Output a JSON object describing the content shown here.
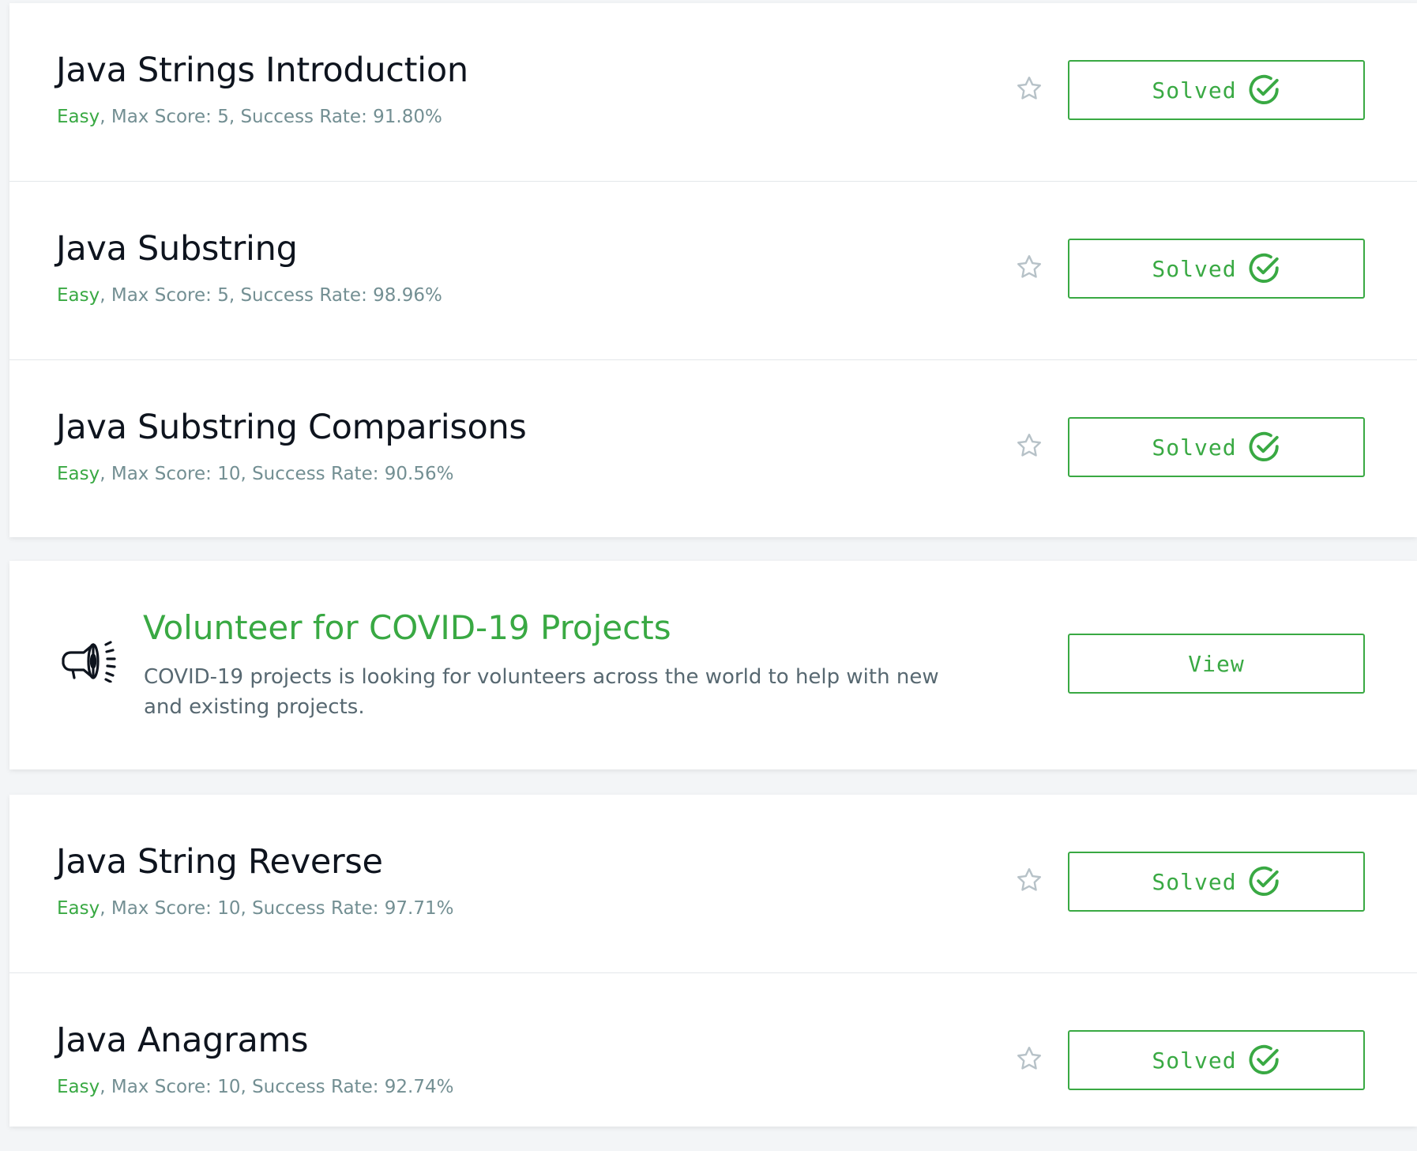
{
  "colors": {
    "accent": "#39a943",
    "text_dark": "#0e141e",
    "text_muted": "#738f93",
    "star": "#b7c2c8"
  },
  "challenges_top": [
    {
      "title": "Java Strings Introduction",
      "difficulty": "Easy",
      "meta": ", Max Score: 5, Success Rate: 91.80%",
      "status": "Solved"
    },
    {
      "title": "Java Substring",
      "difficulty": "Easy",
      "meta": ", Max Score: 5, Success Rate: 98.96%",
      "status": "Solved"
    },
    {
      "title": "Java Substring Comparisons",
      "difficulty": "Easy",
      "meta": ", Max Score: 10, Success Rate: 90.56%",
      "status": "Solved"
    }
  ],
  "promo": {
    "title": "Volunteer for COVID-19 Projects",
    "description": "COVID-19 projects is looking for volunteers across the world to help with new and existing projects.",
    "button": "View",
    "icon": "megaphone-icon"
  },
  "challenges_bottom": [
    {
      "title": "Java String Reverse",
      "difficulty": "Easy",
      "meta": ", Max Score: 10, Success Rate: 97.71%",
      "status": "Solved"
    },
    {
      "title": "Java Anagrams",
      "difficulty": "Easy",
      "meta": ", Max Score: 10, Success Rate: 92.74%",
      "status": "Solved"
    }
  ]
}
